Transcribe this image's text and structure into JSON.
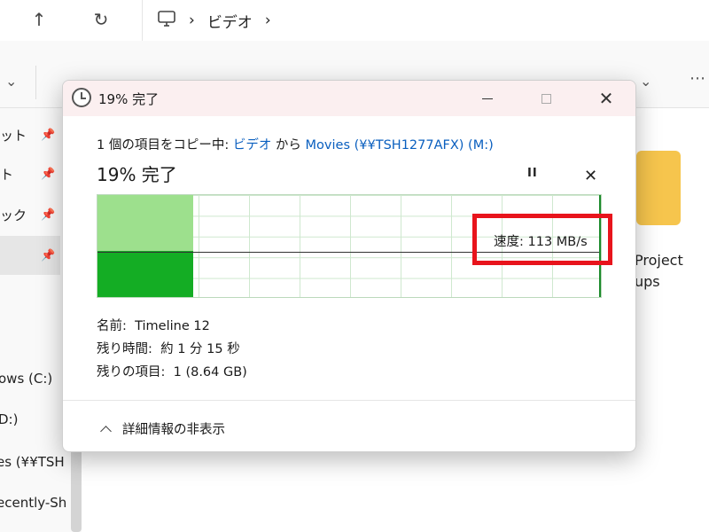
{
  "explorer": {
    "address": {
      "breadcrumb": [
        "ビデオ"
      ]
    },
    "sidebar": {
      "pinned_items": [
        {
          "label": "ット"
        },
        {
          "label": "ト"
        },
        {
          "label": "ック"
        },
        {
          "label": ""
        }
      ],
      "drives": [
        {
          "label": "ows (C:)"
        },
        {
          "label": "D:)"
        },
        {
          "label": "es (¥¥TSH"
        },
        {
          "label": "ecently-Sh"
        }
      ]
    },
    "content": {
      "folder_label_line1": "Project",
      "folder_label_line2": "ups"
    }
  },
  "dialog": {
    "title": "19% 完了",
    "copy_line": {
      "prefix": "1 個の項目をコピー中: ",
      "source": "ビデオ",
      "middle": " から ",
      "destination": "Movies (¥¥TSH1277AFX) (M:)"
    },
    "percent_label": "19% 完了",
    "progress_percent": 19,
    "speed": "速度: 113 MB/s",
    "name_label": "名前:",
    "name_value": "Timeline 12",
    "time_label": "残り時間:",
    "time_value": "約 1 分 15 秒",
    "items_label": "残りの項目:",
    "items_value": "1 (8.64 GB)",
    "details_toggle": "詳細情報の非表示"
  },
  "colors": {
    "graph_light": "#9de08d",
    "graph_dark": "#14ad24",
    "highlight_box": "#e8141c",
    "link": "#0a5fbf",
    "titlebar": "#fbeff0"
  }
}
